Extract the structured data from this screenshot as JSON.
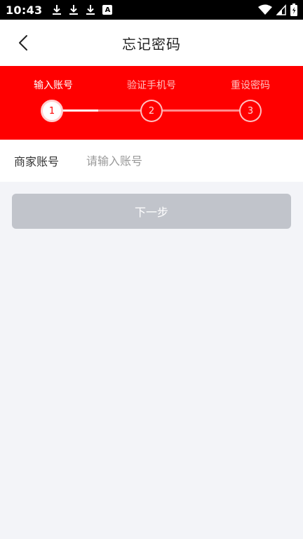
{
  "status_bar": {
    "time": "10:43",
    "icons": [
      "download-icon",
      "download-icon",
      "download-icon",
      "a-icon",
      "wifi-icon",
      "signal-icon",
      "battery-icon"
    ],
    "a_badge": "A"
  },
  "header": {
    "title": "忘记密码",
    "back_icon": "back-arrow-icon"
  },
  "stepper": {
    "steps": [
      {
        "label": "输入账号",
        "number": "1"
      },
      {
        "label": "验证手机号",
        "number": "2"
      },
      {
        "label": "重设密码",
        "number": "3"
      }
    ],
    "active_step": 1
  },
  "form": {
    "account_label": "商家账号",
    "account_placeholder": "请输入账号",
    "account_value": ""
  },
  "actions": {
    "next_label": "下一步"
  },
  "colors": {
    "accent": "#ff0000",
    "button_disabled": "#c1c4cb",
    "background": "#f3f4f8"
  }
}
